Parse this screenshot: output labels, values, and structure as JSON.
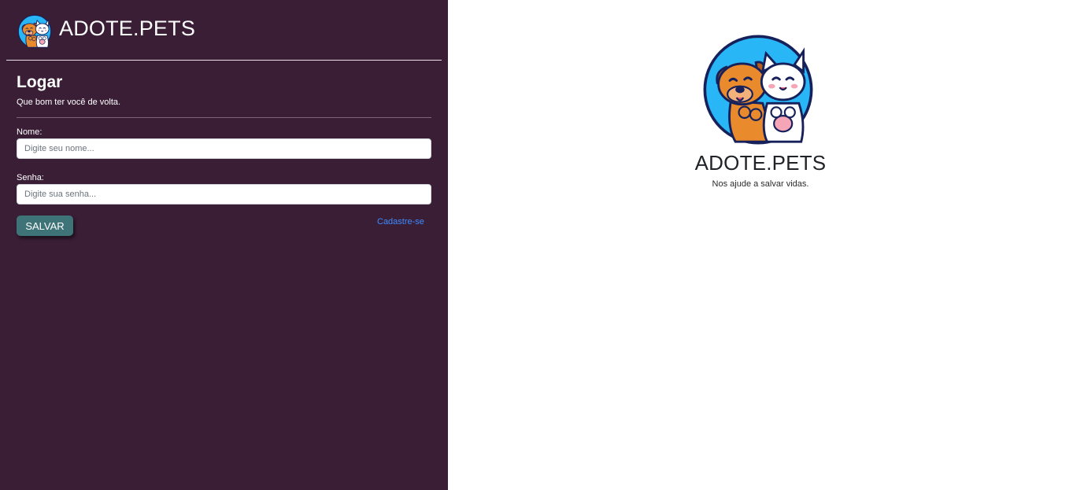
{
  "brand": {
    "title": "ADOTE.PETS",
    "logo_icon": "dog-and-cat-logo-icon"
  },
  "login": {
    "title": "Logar",
    "subtitle": "Que bom ter você de volta.",
    "fields": {
      "name": {
        "label": "Nome:",
        "value": "",
        "placeholder": "Digite seu nome..."
      },
      "password": {
        "label": "Senha:",
        "value": "",
        "placeholder": "Digite sua senha..."
      }
    },
    "save_label": "SALVAR",
    "signup_label": "Cadastre-se"
  },
  "hero": {
    "title": "ADOTE.PETS",
    "tagline": "Nos ajude a salvar vidas.",
    "logo_icon": "dog-and-cat-logo-icon"
  },
  "colors": {
    "sidebar_bg": "#3a1e36",
    "button_bg": "#3e7378",
    "link": "#3d8bfd",
    "logo_circle": "#29b6f6"
  }
}
